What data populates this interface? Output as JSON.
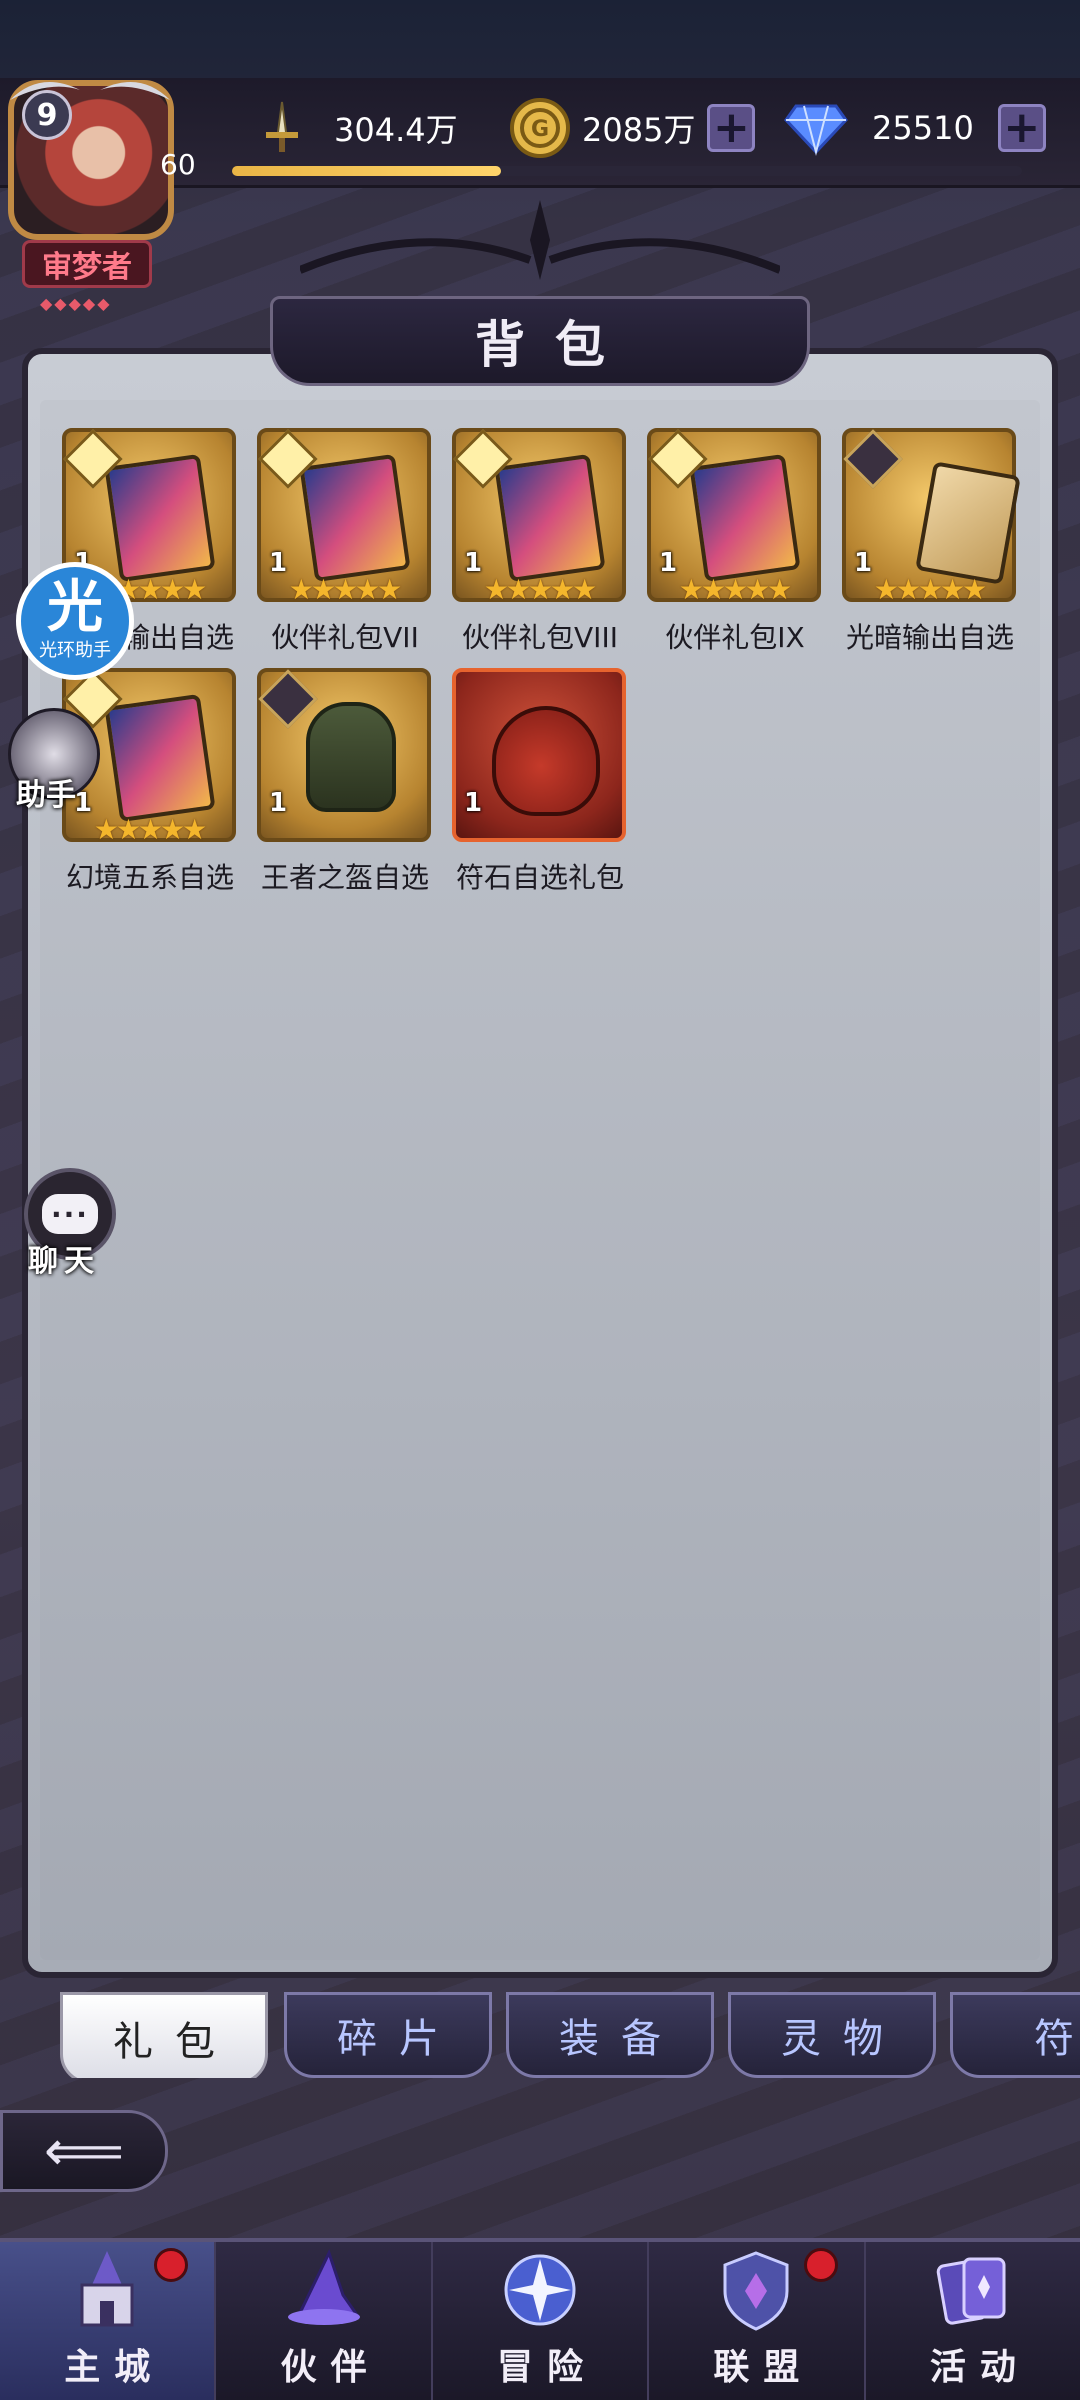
{
  "player": {
    "vip_level": "9",
    "level": "60",
    "title": "审梦者",
    "xp_progress": 0.34
  },
  "resources": {
    "power": "304.4万",
    "gold": "2085万",
    "diamonds": "25510"
  },
  "panel": {
    "title": "背包"
  },
  "items": [
    {
      "label": "光暗输出自选",
      "count": "1",
      "stars": "★★★★★"
    },
    {
      "label": "伙伴礼包VII",
      "count": "1",
      "stars": "★★★★★"
    },
    {
      "label": "伙伴礼包VIII",
      "count": "1",
      "stars": "★★★★★"
    },
    {
      "label": "伙伴礼包IX",
      "count": "1",
      "stars": "★★★★★"
    },
    {
      "label": "光暗输出自选",
      "count": "1",
      "stars": "★★★★★"
    },
    {
      "label": "幻境五系自选",
      "count": "1",
      "stars": "★★★★★"
    },
    {
      "label": "王者之盔自选",
      "count": "1",
      "stars": ""
    },
    {
      "label": "符石自选礼包",
      "count": "1",
      "stars": ""
    }
  ],
  "floating": {
    "aura_big": "光",
    "aura_small": "光环助手",
    "helper_label": "助手",
    "chat_label": "聊天",
    "chat_bubble": "···"
  },
  "tabs": [
    {
      "label": "礼包",
      "active": true
    },
    {
      "label": "碎片"
    },
    {
      "label": "装备"
    },
    {
      "label": "灵物"
    },
    {
      "label": "符"
    }
  ],
  "nav": [
    {
      "label": "主城",
      "icon": "castle-icon",
      "active": true,
      "badge": true
    },
    {
      "label": "伙伴",
      "icon": "wizard-hat-icon"
    },
    {
      "label": "冒险",
      "icon": "compass-star-icon"
    },
    {
      "label": "联盟",
      "icon": "shield-crest-icon",
      "badge": true
    },
    {
      "label": "活动",
      "icon": "cards-icon"
    }
  ],
  "colors": {
    "gold": "#f4b62c",
    "accent_purple": "#5a4f86",
    "badge_red": "#d8202c"
  }
}
